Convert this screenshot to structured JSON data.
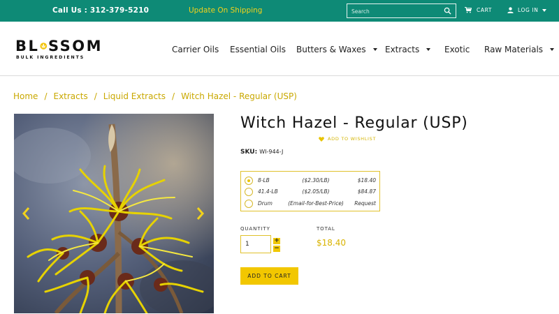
{
  "topbar": {
    "call": "Call Us : 312-379-5210",
    "promo": "Update On Shipping",
    "search_placeholder": "Search",
    "cart_label": "CART",
    "login_label": "LOG IN"
  },
  "brand": {
    "logo_text_left": "BL",
    "logo_text_right": "SSOM",
    "logo_tagline": "BULK INGREDIENTS"
  },
  "nav": {
    "items": [
      {
        "label": "Carrier Oils",
        "dropdown": false
      },
      {
        "label": "Essential Oils",
        "dropdown": false
      },
      {
        "label": "Butters & Waxes",
        "dropdown": true
      },
      {
        "label": "Extracts",
        "dropdown": true
      },
      {
        "label": "Exotic",
        "dropdown": false
      },
      {
        "label": "Raw Materials",
        "dropdown": true
      }
    ]
  },
  "breadcrumb": {
    "items": [
      "Home",
      "Extracts",
      "Liquid Extracts",
      "Witch Hazel - Regular (USP)"
    ],
    "separator": "/"
  },
  "product": {
    "title": "Witch Hazel - Regular (USP)",
    "wishlist_label": "ADD TO WISHLIST",
    "sku_label": "SKU:",
    "sku_value": "WI-944-J",
    "options": [
      {
        "size": "8-LB",
        "unit_price": "($2.30/LB)",
        "price": "$18.40",
        "selected": true
      },
      {
        "size": "41.4-LB",
        "unit_price": "($2.05/LB)",
        "price": "$84.87",
        "selected": false
      },
      {
        "size": "Drum",
        "unit_price": "(Email-for-Best-Price)",
        "price": "Request",
        "selected": false
      }
    ],
    "quantity_label": "QUANTITY",
    "quantity_value": "1",
    "total_label": "TOTAL",
    "total_value": "$18.40",
    "add_to_cart_label": "ADD TO CART"
  },
  "colors": {
    "topbar_bg": "#0e8a76",
    "accent_yellow": "#f2c700",
    "link_gold": "#c9a800"
  },
  "icons": [
    "search-icon",
    "cart-icon",
    "user-icon",
    "heart-icon",
    "chevron-left-icon",
    "chevron-right-icon",
    "lotus-logo-icon"
  ]
}
